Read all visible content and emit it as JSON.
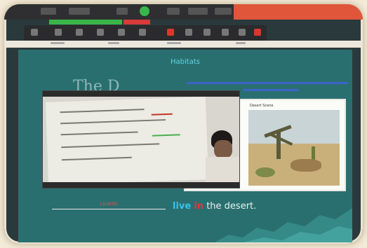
{
  "slide": {
    "title": "Habitats",
    "heading_partial": "The D",
    "fill_blank_answer": "Lizards",
    "sentence": {
      "word_live": "live",
      "word_in": "in",
      "rest": "the desert."
    },
    "picture_caption": "Desert Scene"
  },
  "colors": {
    "slide_bg": "#2a6f70",
    "title": "#5fd6e4",
    "accent_blue": "#37c3ea",
    "accent_red": "#d93a3a",
    "record_green": "#3ab54a"
  }
}
